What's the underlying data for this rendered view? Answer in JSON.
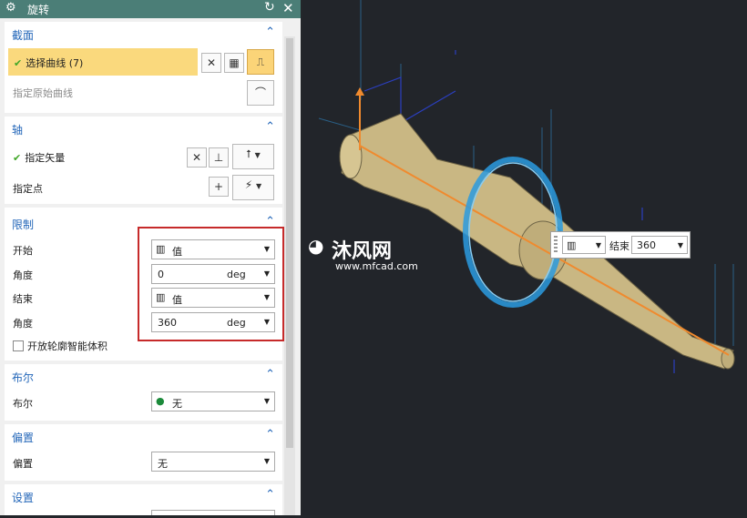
{
  "dialog": {
    "title": "旋转",
    "sections": {
      "section": {
        "title": "截面",
        "select_curve": "选择曲线 (7)",
        "specify_origin_curve": "指定原始曲线"
      },
      "axis": {
        "title": "轴",
        "specify_vector": "指定矢量",
        "specify_point": "指定点"
      },
      "limits": {
        "title": "限制",
        "start_label": "开始",
        "start_type": "值",
        "start_angle_label": "角度",
        "start_angle_value": "0",
        "start_angle_unit": "deg",
        "end_label": "结束",
        "end_type": "值",
        "end_angle_label": "角度",
        "end_angle_value": "360",
        "end_angle_unit": "deg",
        "open_profile_label": "开放轮廓智能体积"
      },
      "boolean": {
        "title": "布尔",
        "label": "布尔",
        "value": "无"
      },
      "offset": {
        "title": "偏置",
        "label": "偏置",
        "value": "无"
      },
      "settings": {
        "title": "设置"
      }
    }
  },
  "viewport_callout": {
    "end_label": "结束",
    "end_value": "360"
  },
  "watermark": {
    "brand": "沐风网",
    "url": "www.mfcad.com"
  },
  "colors": {
    "title_bar": "#4b7e77",
    "section_title": "#2467b9",
    "highlight": "#fad97d",
    "check": "#41a728",
    "annotation_box": "#c62a2a",
    "viewport_bg": "#22252a",
    "part": "#c9b783",
    "axis_line": "#f08a2e",
    "rotate_handle": "#2a9be0"
  },
  "icons": {
    "dialog": "gear-icon",
    "reset": "reset-icon",
    "close": "close-icon",
    "collapse": "chevron-up-icon",
    "dropdown": "chevron-down-icon"
  }
}
